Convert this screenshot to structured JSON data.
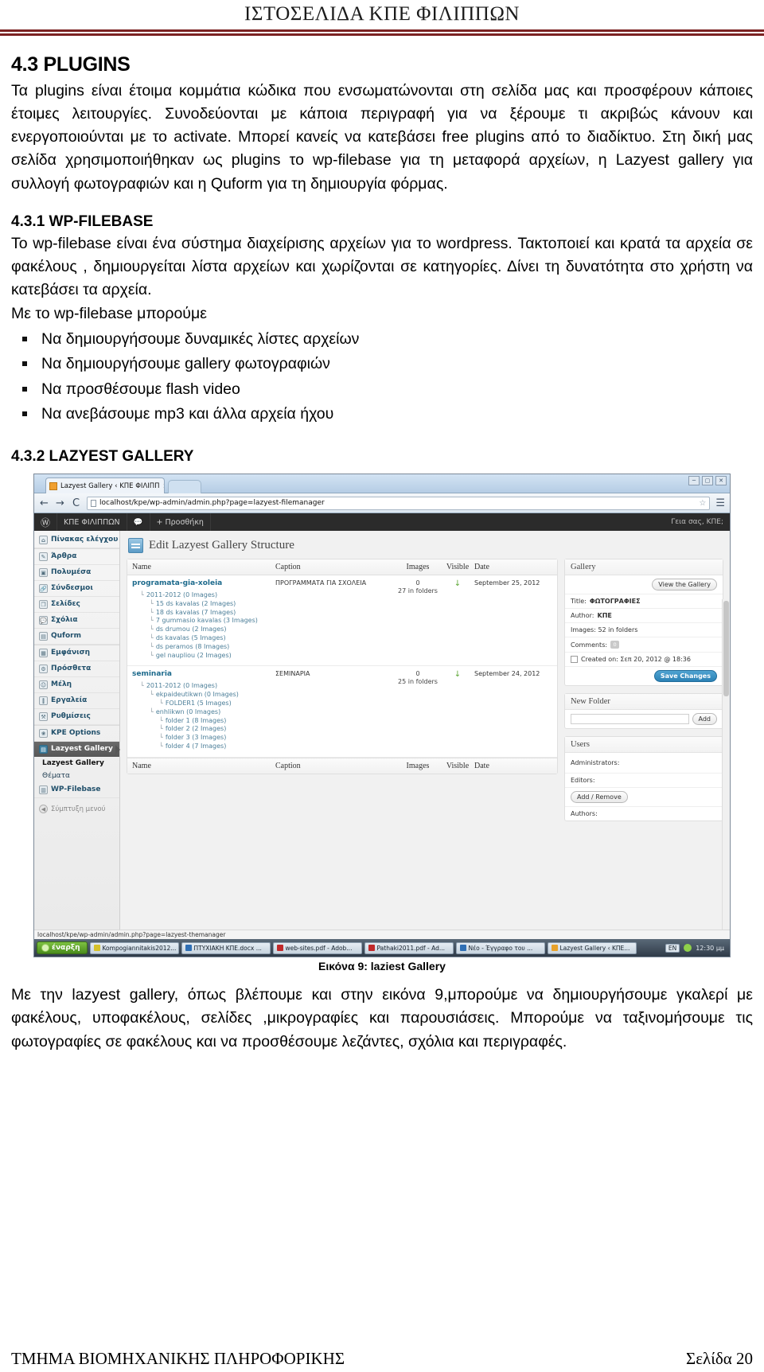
{
  "header": {
    "title": "ΙΣΤΟΣΕΛΙΔΑ ΚΠΕ ΦΙΛΙΠΠΩΝ"
  },
  "footer": {
    "department": "ΤΜΗΜΑ ΒΙΟΜΗΧΑΝΙΚΗΣ ΠΛΗΡΟΦΟΡΙΚΗΣ",
    "page": "Σελίδα 20"
  },
  "sections": {
    "plugins": {
      "heading": "4.3 PLUGINS",
      "paragraph": "Τα plugins είναι έτοιμα κομμάτια κώδικα που ενσωματώνονται στη σελίδα μας και προσφέρουν κάποιες έτοιμες λειτουργίες. Συνοδεύονται με κάποια περιγραφή για να ξέρουμε τι ακριβώς κάνουν και ενεργοποιούνται με το activate. Μπορεί κανείς να κατεβάσει free plugins από το διαδίκτυο.  Στη δική μας σελίδα χρησιμοποιήθηκαν ως plugins το wp-filebase για τη μεταφορά αρχείων, η Lazyest   gallery για συλλογή φωτογραφιών και  η Quform για τη δημιουργία φόρμας."
    },
    "wpfilebase": {
      "heading": "4.3.1  WP-FILEBASE",
      "paragraph": "Το wp-filebase είναι ένα σύστημα διαχείρισης αρχείων για το wordpress. Τακτοποιεί  και κρατά τα αρχεία σε φακέλους ,  δημιουργείται λίστα αρχείων και χωρίζονται σε κατηγορίες. Δίνει τη δυνατότητα στο χρήστη να κατεβάσει τα αρχεία.",
      "list_intro": " Με το wp-filebase μπορούμε",
      "bullets": [
        "Να δημιουργήσουμε δυναμικές λίστες αρχείων",
        "Να δημιουργήσουμε gallery  φωτογραφιών",
        "Να προσθέσουμε  flash video",
        "Να ανεβάσουμε mp3 και άλλα αρχεία ήχου"
      ]
    },
    "lazyest": {
      "heading": "4.3.2 LAZYEST GALLERY",
      "figure_caption": "Εικόνα 9: laziest Gallery",
      "paragraph": "Με την  lazyest gallery, όπως βλέπουμε και στην εικόνα 9,μπορούμε να δημιουργήσουμε γκαλερί με φακέλους, υποφακέλους, σελίδες ,μικρογραφίες και παρουσιάσεις. Μπορούμε να ταξινομήσουμε  τις φωτογραφίες σε φακέλους και να προσθέσουμε λεζάντες, σχόλια και περιγραφές."
    }
  },
  "screenshot": {
    "browser": {
      "tab_title": "Lazyest Gallery ‹ ΚΠΕ ΦΙΛΙΠΠ",
      "tab_close": "×",
      "back_icon": "←",
      "forward_icon": "→",
      "reload_icon": "C",
      "url": "localhost/kpe/wp-admin/admin.php?page=lazyest-filemanager",
      "star_icon": "☆",
      "menu_icon": "☰",
      "window_buttons": [
        "─",
        "▢",
        "✕"
      ]
    },
    "adminbar": {
      "logo_icon": "Ⓦ",
      "site_name": "ΚΠΕ ΦΙΛΙΠΠΩΝ",
      "comments_icon": "💬",
      "new_label": "+ Προσθήκη",
      "greeting": "Γεια σας, ΚΠΕ;"
    },
    "sidebar": {
      "items": [
        {
          "label": "Πίνακας ελέγχου",
          "icon": "⌂"
        },
        {
          "label": "Άρθρα",
          "icon": "✎"
        },
        {
          "label": "Πολυμέσα",
          "icon": "▣"
        },
        {
          "label": "Σύνδεσμοι",
          "icon": "🔗"
        },
        {
          "label": "Σελίδες",
          "icon": "❐"
        },
        {
          "label": "Σχόλια",
          "icon": "💬"
        },
        {
          "label": "Quform",
          "icon": "▤"
        },
        {
          "label": "Εμφάνιση",
          "icon": "▦"
        },
        {
          "label": "Πρόσθετα",
          "icon": "⚙"
        },
        {
          "label": "Μέλη",
          "icon": "☺"
        },
        {
          "label": "Εργαλεία",
          "icon": "⫿"
        },
        {
          "label": "Ρυθμίσεις",
          "icon": "⚒"
        },
        {
          "label": "KPE Options",
          "icon": "❀"
        }
      ],
      "active_item": {
        "label": "Lazyest Gallery",
        "icon": "▤"
      },
      "submenu": [
        {
          "label": "Lazyest Gallery",
          "current": true
        },
        {
          "label": "Θέματα",
          "current": false
        }
      ],
      "after_items": [
        {
          "label": "WP-Filebase",
          "icon": "▥"
        }
      ],
      "collapse": {
        "label": "Σύμπτυξη μενού",
        "icon": "◀"
      }
    },
    "main": {
      "page_title": "Edit Lazyest Gallery Structure",
      "table": {
        "columns": [
          "Name",
          "Caption",
          "Images",
          "Visible",
          "Date"
        ],
        "rows": [
          {
            "name": "programata-gia-xoleia",
            "caption": "ΠΡΟΓΡΑΜΜΑΤΑ ΓΙΑ ΣΧΟΛΕΙΑ",
            "images_count": "0",
            "images_note": "27 in folders",
            "visible_icon": "↓",
            "date": "September 25, 2012",
            "tree": [
              {
                "level": 1,
                "label": "2011-2012 (0 Images)"
              },
              {
                "level": 2,
                "label": "15 ds kavalas (2 Images)"
              },
              {
                "level": 2,
                "label": "18 ds kavalas (7 Images)"
              },
              {
                "level": 2,
                "label": "7 gummasio kavalas (3 Images)"
              },
              {
                "level": 2,
                "label": "ds drumou (2 Images)"
              },
              {
                "level": 2,
                "label": "ds kavalas (5 Images)"
              },
              {
                "level": 2,
                "label": "ds peramos (8 Images)"
              },
              {
                "level": 2,
                "label": "gel naupliou (2 Images)"
              }
            ]
          },
          {
            "name": "seminaria",
            "caption": "ΣΕΜΙΝΑΡΙΑ",
            "images_count": "0",
            "images_note": "25 in folders",
            "visible_icon": "↓",
            "date": "September 24, 2012",
            "tree": [
              {
                "level": 1,
                "label": "2011-2012 (0 Images)"
              },
              {
                "level": 2,
                "label": "ekpaideutikwn (0 Images)"
              },
              {
                "level": 3,
                "label": "FOLDER1 (5 Images)"
              },
              {
                "level": 2,
                "label": "enhlikwn (0 Images)"
              },
              {
                "level": 3,
                "label": "folder 1 (8 Images)"
              },
              {
                "level": 3,
                "label": "folder 2 (2 Images)"
              },
              {
                "level": 3,
                "label": "folder 3 (3 Images)"
              },
              {
                "level": 3,
                "label": "folder 4 (7 Images)"
              }
            ]
          }
        ]
      },
      "gallery_panel": {
        "heading": "Gallery",
        "view_button": "View the Gallery",
        "title_label": "Title:",
        "title_value": "ΦΩΤΟΓΡΑΦΙΕΣ",
        "author_label": "Author:",
        "author_value": "ΚΠΕ",
        "images_label": "Images: 52 in folders",
        "comments_label": "Comments:",
        "comments_count": "0",
        "created_label": "Created on: Σεπ 20, 2012 @ 18:36",
        "save_button": "Save Changes"
      },
      "new_folder_panel": {
        "heading": "New Folder",
        "input_value": "",
        "input_placeholder": "",
        "add_button": "Add"
      },
      "users_panel": {
        "heading": "Users",
        "administrators_label": "Administrators:",
        "editors_label": "Editors:",
        "add_remove_button": "Add / Remove",
        "authors_label": "Authors:"
      },
      "status_text": "localhost/kpe/wp-admin/admin.php?page=lazyest-themanager"
    },
    "taskbar": {
      "start_label": "έναρξη",
      "items": [
        {
          "label": "Kompogiannitakis2012...",
          "color": "#d6c12a"
        },
        {
          "label": "ΠΤΥΧΙΑΚΗ ΚΠΕ.docx ...",
          "color": "#2f6fb5"
        },
        {
          "label": "web-sites.pdf - Adob...",
          "color": "#c1292a"
        },
        {
          "label": "Pathaki2011.pdf - Ad...",
          "color": "#c1292a"
        },
        {
          "label": "Νέο - Έγγραφο του ...",
          "color": "#2f6fb5"
        },
        {
          "label": "Lazyest Gallery ‹ ΚΠΕ...",
          "color": "#e8a22b"
        }
      ],
      "language": "EN",
      "clock": "12:30 μμ"
    }
  }
}
